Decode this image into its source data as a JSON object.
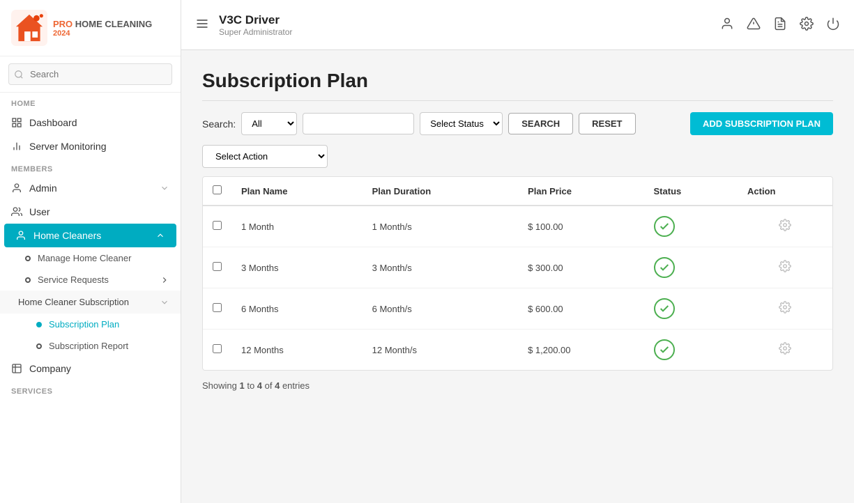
{
  "logo": {
    "pro": "PRO",
    "home": "HOME CLEANING",
    "year": "2024"
  },
  "sidebar": {
    "search_placeholder": "Search",
    "home_section": "HOME",
    "members_section": "MEMBERS",
    "services_section": "SERVICES",
    "nav_items": [
      {
        "id": "dashboard",
        "label": "Dashboard",
        "icon": "grid"
      },
      {
        "id": "server-monitoring",
        "label": "Server Monitoring",
        "icon": "bar-chart"
      }
    ],
    "members_items": [
      {
        "id": "admin",
        "label": "Admin",
        "icon": "person",
        "has_chevron": true
      },
      {
        "id": "user",
        "label": "User",
        "icon": "people"
      }
    ],
    "home_cleaners": {
      "label": "Home Cleaners",
      "icon": "person-badge",
      "active": true,
      "children": [
        {
          "id": "manage-home-cleaner",
          "label": "Manage Home Cleaner",
          "active": false
        },
        {
          "id": "service-requests",
          "label": "Service Requests",
          "has_chevron": true
        }
      ]
    },
    "home_cleaner_sub": {
      "label": "Home Cleaner Subscription",
      "expanded": true,
      "children": [
        {
          "id": "subscription-plan",
          "label": "Subscription Plan",
          "active": true
        },
        {
          "id": "subscription-report",
          "label": "Subscription Report",
          "active": false
        }
      ]
    },
    "company": {
      "label": "Company",
      "icon": "building"
    }
  },
  "topbar": {
    "title": "V3C Driver",
    "subtitle": "Super Administrator",
    "icons": [
      "user",
      "alert-triangle",
      "file-text",
      "gear",
      "power"
    ]
  },
  "page": {
    "title": "Subscription Plan",
    "search_label": "Search:",
    "search_all_option": "All",
    "select_status_placeholder": "Select Status",
    "select_action_placeholder": "Select Action",
    "btn_search": "SEARCH",
    "btn_reset": "RESET",
    "btn_add": "ADD SUBSCRIPTION PLAN",
    "table": {
      "headers": [
        "Plan Name",
        "Plan Duration",
        "Plan Price",
        "Status",
        "Action"
      ],
      "rows": [
        {
          "plan_name": "1 Month",
          "plan_duration": "1 Month/s",
          "plan_price": "$ 100.00",
          "status": "active"
        },
        {
          "plan_name": "3 Months",
          "plan_duration": "3 Month/s",
          "plan_price": "$ 300.00",
          "status": "active"
        },
        {
          "plan_name": "6 Months",
          "plan_duration": "6 Month/s",
          "plan_price": "$ 600.00",
          "status": "active"
        },
        {
          "plan_name": "12 Months",
          "plan_duration": "12 Month/s",
          "plan_price": "$ 1,200.00",
          "status": "active"
        }
      ]
    },
    "entries_showing": "Showing",
    "entries_from": "1",
    "entries_to": "4",
    "entries_of": "of",
    "entries_total": "4",
    "entries_label": "entries"
  }
}
